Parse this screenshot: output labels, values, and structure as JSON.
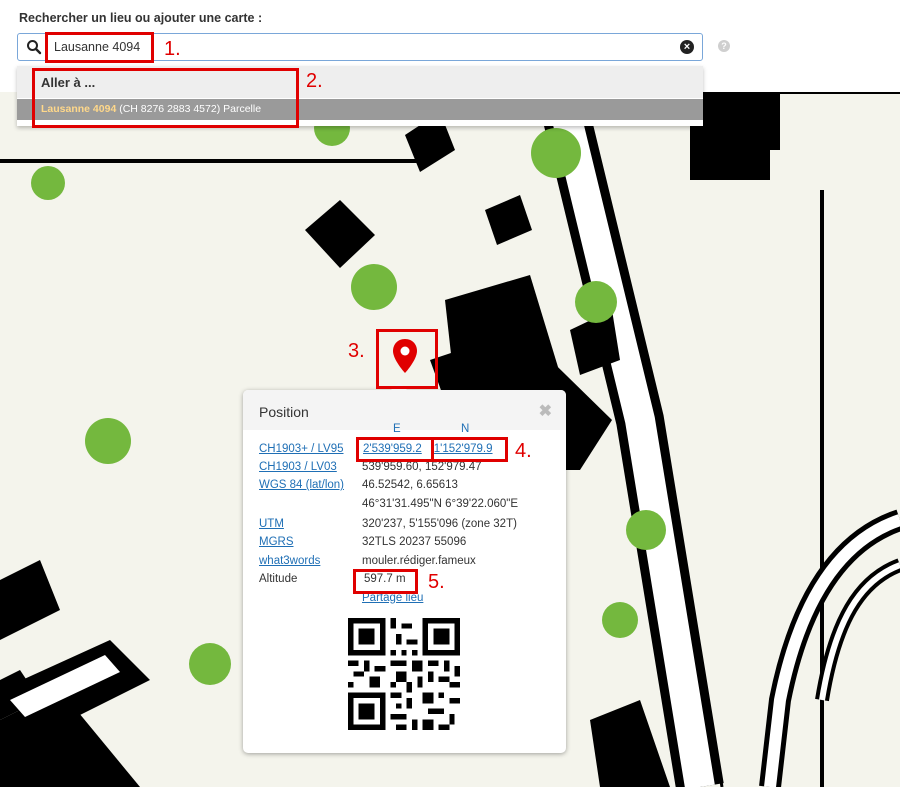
{
  "search": {
    "title": "Rechercher un lieu ou ajouter une carte :",
    "value": "Lausanne 4094",
    "placeholder": ""
  },
  "dropdown": {
    "header": "Aller à ...",
    "result_highlight": "Lausanne 4094",
    "result_rest": " (CH 8276 2883 4572) ",
    "result_type": "Parcelle"
  },
  "icons": {
    "search": "search-icon",
    "clear": "clear-icon",
    "help": "help-icon",
    "marker": "map-marker-icon",
    "close": "close-icon"
  },
  "annotations": [
    "1.",
    "2.",
    "3.",
    "4.",
    "5."
  ],
  "popup": {
    "title": "Position",
    "close": "✖",
    "col_e": "E",
    "col_n": "N",
    "rows": [
      {
        "label": "CH1903+ / LV95",
        "value_e": "2'539'959.2",
        "value_n": "1'152'979.9"
      },
      {
        "label": "CH1903 / LV03",
        "value": "539'959.60, 152'979.47"
      },
      {
        "label": "WGS 84 (lat/lon)",
        "value": "46.52542, 6.65613"
      },
      {
        "label": "",
        "value": "46°31'31.495\"N 6°39'22.060\"E"
      },
      {
        "label": "UTM",
        "value": "320'237, 5'155'096 (zone 32T)"
      },
      {
        "label": "MGRS",
        "value": "32TLS 20237 55096"
      },
      {
        "label": "what3words",
        "value": "mouler.rédiger.fameux"
      },
      {
        "label": "Altitude",
        "value": "597.7 m"
      }
    ],
    "share": "Partage lieu"
  },
  "colors": {
    "annotation_red": "#e00000",
    "link_blue": "#1f6fb5",
    "map_background": "#f4f4ec",
    "tree_green": "#74b83e",
    "building_black": "#000000"
  }
}
